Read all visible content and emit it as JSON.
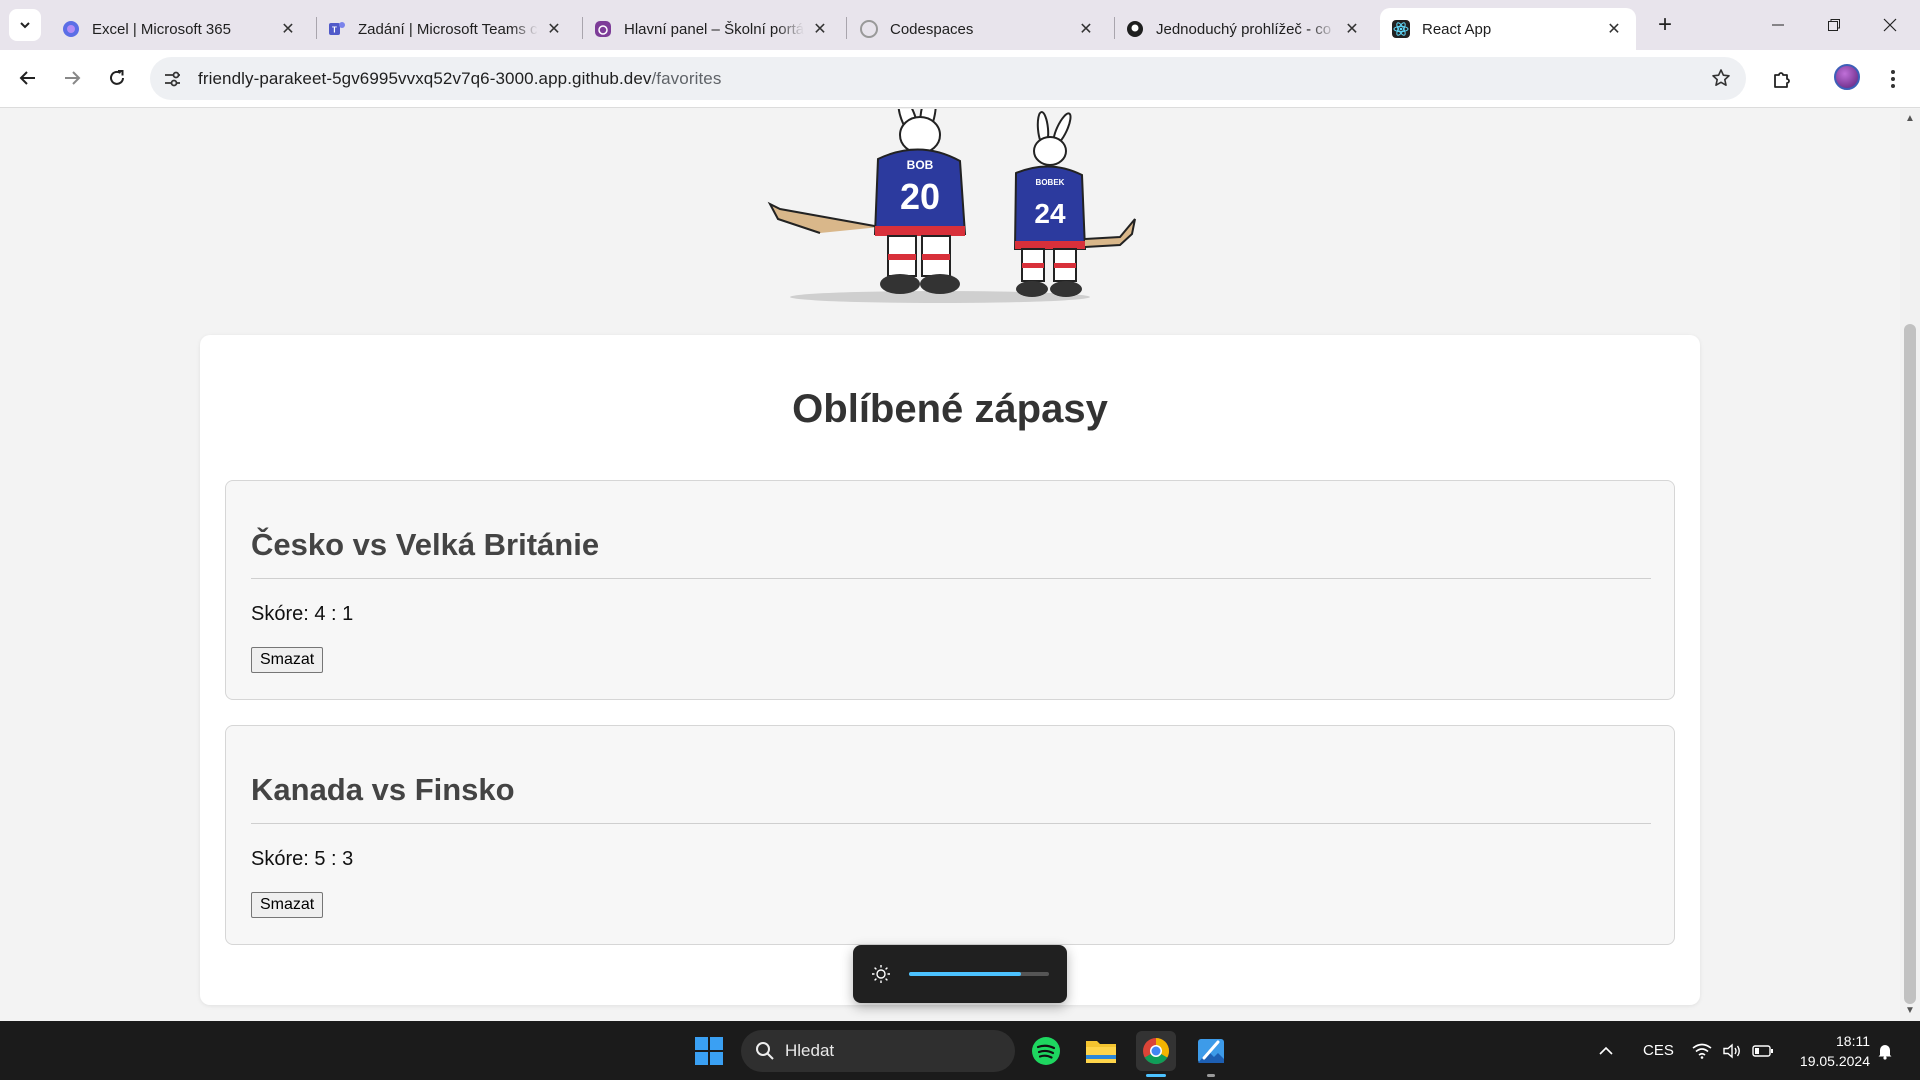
{
  "browser": {
    "tabs": [
      {
        "title": "Excel | Microsoft 365",
        "icon": "copilot-icon",
        "active": false
      },
      {
        "title": "Zadání | Microsoft Teams c",
        "icon": "teams-icon",
        "active": false
      },
      {
        "title": "Hlavní panel – Školní portá",
        "icon": "moodle-icon",
        "active": false
      },
      {
        "title": "Codespaces",
        "icon": "github-icon",
        "active": false
      },
      {
        "title": "Jednoduchý prohlížeč - co",
        "icon": "github-icon",
        "active": false
      },
      {
        "title": "React App",
        "icon": "react-icon",
        "active": true
      }
    ],
    "url_host": "friendly-parakeet-5gv6995vvxq52v7q6-3000.app.github.dev",
    "url_path": "/favorites"
  },
  "page": {
    "title": "Oblíbené zápasy",
    "mascot_jerseys": [
      "BOB",
      "20",
      "BOBEK",
      "24"
    ],
    "matches": [
      {
        "name": "Česko vs Velká Británie",
        "score": "Skóre: 4 : 1",
        "delete_label": "Smazat"
      },
      {
        "name": "Kanada vs Finsko",
        "score": "Skóre: 5 : 3",
        "delete_label": "Smazat"
      }
    ]
  },
  "osd": {
    "brightness_fraction": 0.8
  },
  "taskbar": {
    "search_placeholder": "Hledat",
    "language": "CES",
    "time": "18:11",
    "date": "19.05.2024"
  },
  "colors": {
    "accent": "#4cc2ff",
    "card_bg": "#ffffff",
    "page_bg": "#f3f3f3",
    "title": "#333333"
  }
}
